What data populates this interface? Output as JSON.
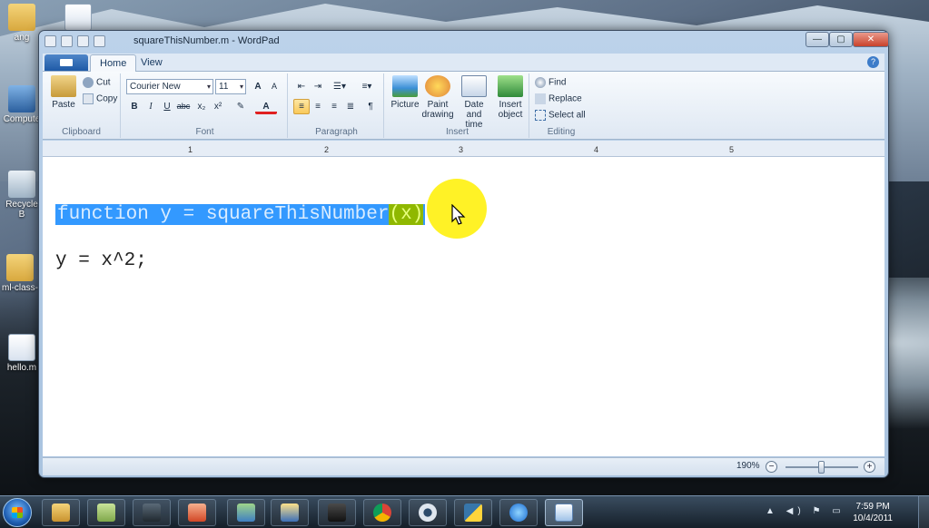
{
  "desktop": {
    "icons": [
      {
        "label": "ang"
      },
      {
        "label": ""
      },
      {
        "label": "Compute"
      },
      {
        "label": "Recycle B"
      },
      {
        "label": "ml-class-"
      },
      {
        "label": "hello.m"
      }
    ]
  },
  "window": {
    "title": "squareThisNumber.m - WordPad",
    "controls": {
      "minimize": "—",
      "maximize": "▢",
      "close": "✕"
    }
  },
  "ribbon": {
    "tabs": [
      "Home",
      "View"
    ],
    "help": "?",
    "clipboard": {
      "label": "Clipboard",
      "paste": "Paste",
      "cut": "Cut",
      "copy": "Copy"
    },
    "font": {
      "label": "Font",
      "family": "Courier New",
      "size": "11",
      "grow": "A",
      "shrink": "A",
      "bold": "B",
      "italic": "I",
      "underline": "U",
      "strike": "abc",
      "subscript": "x₂",
      "superscript": "x²",
      "text_color": "A"
    },
    "paragraph": {
      "label": "Paragraph"
    },
    "insert": {
      "label": "Insert",
      "picture": "Picture",
      "paint": "Paint drawing",
      "datetime": "Date and time",
      "object": "Insert object"
    },
    "editing": {
      "label": "Editing",
      "find": "Find",
      "replace": "Replace",
      "select_all": "Select all"
    }
  },
  "ruler": {
    "marks": [
      "1",
      "2",
      "3",
      "4",
      "5"
    ]
  },
  "document": {
    "line1_main": "function y = squareThisNumber",
    "line1_tail": "(x)",
    "line2": "y = x^2;"
  },
  "status": {
    "zoom": "190%",
    "zoom_out": "−",
    "zoom_in": "+",
    "zoom_level": 0.55
  },
  "taskbar": {
    "time": "7:59 PM",
    "date": "10/4/2011",
    "tray": "▲ ◀) ⚑ ▭"
  },
  "colors": {
    "selection": "#3399ff",
    "highlight": "#fff000",
    "accent": "#1f5aa6"
  }
}
